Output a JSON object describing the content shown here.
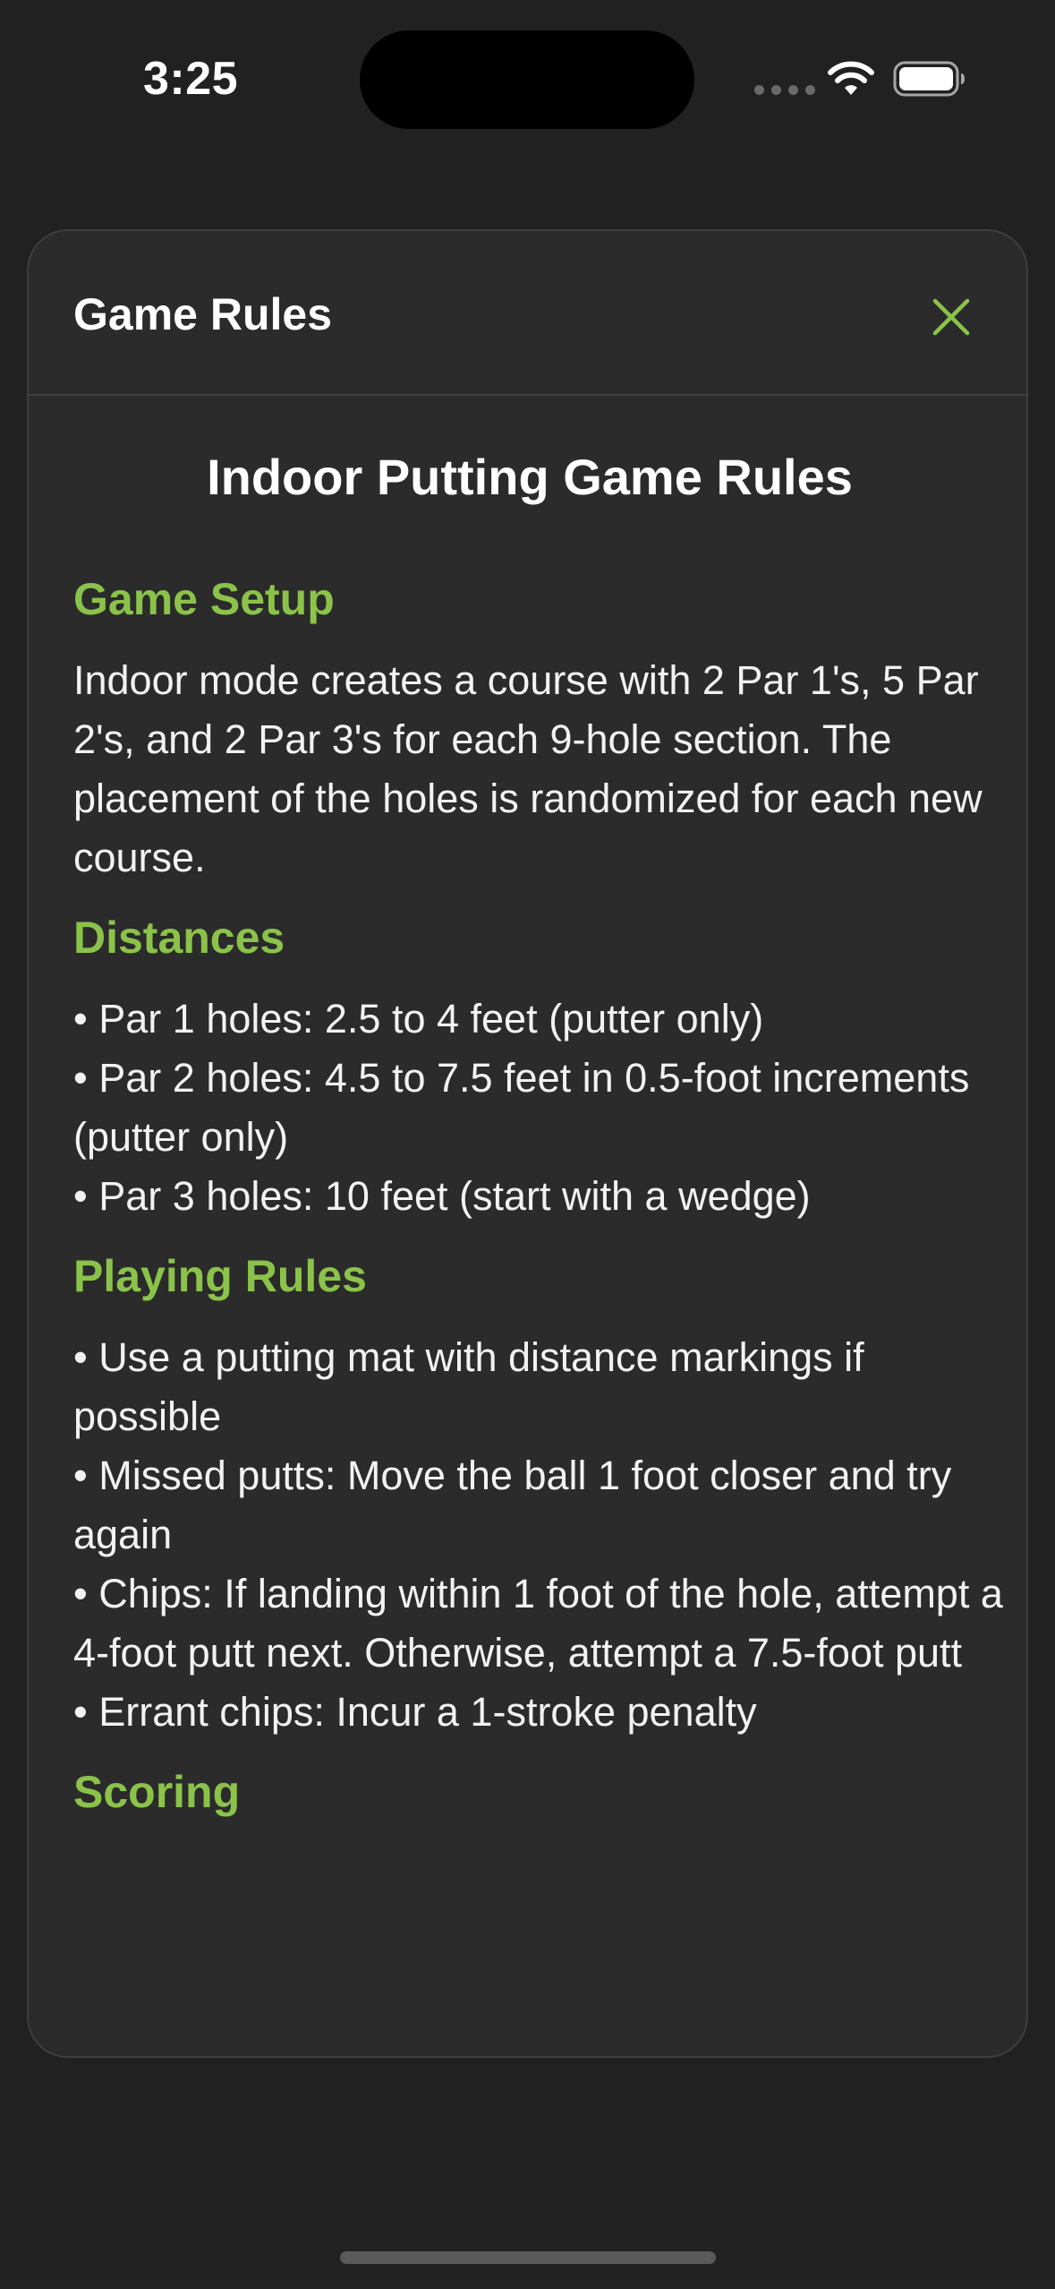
{
  "status_bar": {
    "time": "3:25",
    "icons": [
      "cellular-signal-icon",
      "wifi-icon",
      "battery-icon"
    ]
  },
  "colors": {
    "accent": "#8bc34a",
    "background": "#212121",
    "sheet": "#2b2b2b"
  },
  "sheet": {
    "title": "Game Rules",
    "close_icon": "close-icon"
  },
  "rules": {
    "title": "Indoor Putting Game Rules",
    "setup": {
      "heading": "Game Setup",
      "body": "Indoor mode creates a course with 2 Par 1's, 5 Par 2's, and 2 Par 3's for each 9-hole section. The placement of the holes is randomized for each new course."
    },
    "distances": {
      "heading": "Distances",
      "items": [
        "• Par 1 holes: 2.5 to 4 feet (putter only)",
        "• Par 2 holes: 4.5 to 7.5 feet in 0.5-foot increments (putter only)",
        "• Par 3 holes: 10 feet (start with a wedge)"
      ]
    },
    "playing": {
      "heading": "Playing Rules",
      "items": [
        "• Use a putting mat with distance markings if possible",
        "• Missed putts: Move the ball 1 foot closer and try again",
        "• Chips: If landing within 1 foot of the hole, attempt a 4-foot putt next. Otherwise, attempt a 7.5-foot putt",
        "• Errant chips: Incur a 1-stroke penalty"
      ]
    },
    "scoring": {
      "heading": "Scoring"
    }
  }
}
